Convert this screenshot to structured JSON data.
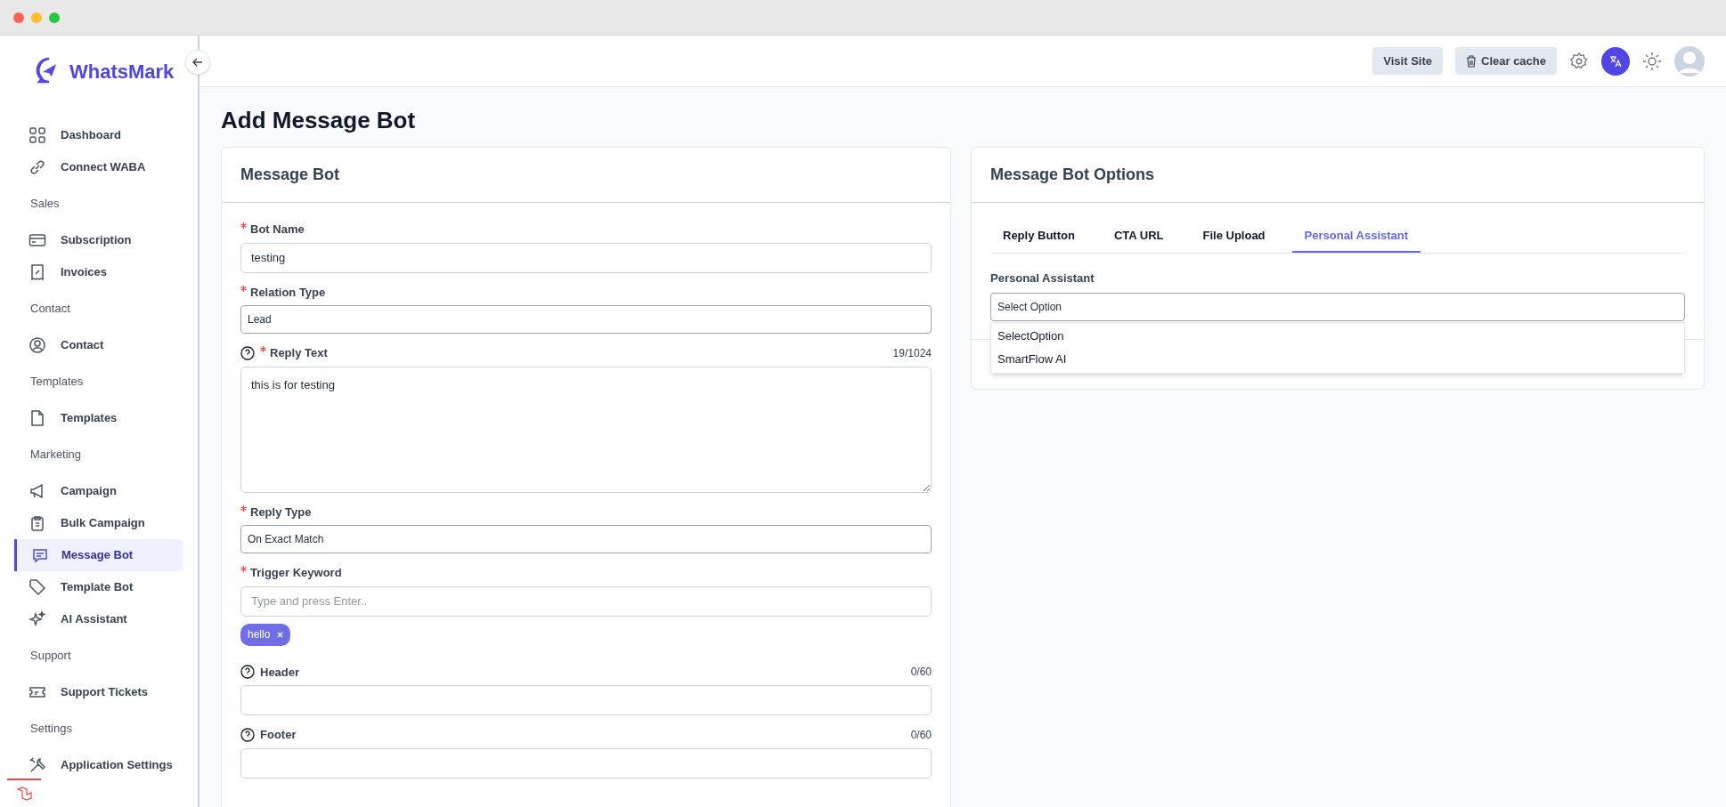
{
  "brand": {
    "name": "WhatsMark"
  },
  "sidebar": {
    "items": [
      {
        "kind": "item",
        "label": "Dashboard",
        "selected": false
      },
      {
        "kind": "item",
        "label": "Connect WABA",
        "selected": false
      },
      {
        "kind": "section",
        "label": "Sales"
      },
      {
        "kind": "item",
        "label": "Subscription",
        "selected": false
      },
      {
        "kind": "item",
        "label": "Invoices",
        "selected": false
      },
      {
        "kind": "section",
        "label": "Contact"
      },
      {
        "kind": "item",
        "label": "Contact",
        "selected": false
      },
      {
        "kind": "section",
        "label": "Templates"
      },
      {
        "kind": "item",
        "label": "Templates",
        "selected": false
      },
      {
        "kind": "section",
        "label": "Marketing"
      },
      {
        "kind": "item",
        "label": "Campaign",
        "selected": false
      },
      {
        "kind": "item",
        "label": "Bulk Campaign",
        "selected": false
      },
      {
        "kind": "item",
        "label": "Message Bot",
        "selected": true
      },
      {
        "kind": "item",
        "label": "Template Bot",
        "selected": false
      },
      {
        "kind": "item",
        "label": "AI Assistant",
        "selected": false
      },
      {
        "kind": "section",
        "label": "Support"
      },
      {
        "kind": "item",
        "label": "Support Tickets",
        "selected": false
      },
      {
        "kind": "section",
        "label": "Settings"
      },
      {
        "kind": "item",
        "label": "Application Settings",
        "selected": false
      }
    ]
  },
  "header": {
    "buttons": [
      {
        "label": "Visit Site"
      },
      {
        "label": "Clear cache"
      }
    ]
  },
  "page": {
    "title": "Add Message Bot"
  },
  "form": {
    "title": "Message Bot",
    "fields": [
      {
        "kind": "input",
        "label": "Bot Name",
        "required": true,
        "help": false,
        "value": "testing"
      },
      {
        "kind": "select",
        "label": "Relation Type",
        "required": true,
        "help": false,
        "value": "Lead"
      },
      {
        "kind": "textarea",
        "label": "Reply Text",
        "required": true,
        "help": true,
        "counter": "19/1024",
        "value": "this is for testing"
      },
      {
        "kind": "select",
        "label": "Reply Type",
        "required": true,
        "help": false,
        "value": "On Exact Match"
      },
      {
        "kind": "tags",
        "label": "Trigger Keyword",
        "required": true,
        "help": false,
        "placeholder": "Type and press Enter..",
        "tags": [
          "hello"
        ]
      },
      {
        "kind": "input",
        "label": "Header",
        "required": false,
        "help": true,
        "counter": "0/60"
      },
      {
        "kind": "input",
        "label": "Footer",
        "required": false,
        "help": true,
        "counter": "0/60"
      }
    ]
  },
  "options": {
    "title": "Message Bot Options",
    "tabs": [
      {
        "label": "Reply Button",
        "selected": false
      },
      {
        "label": "CTA URL",
        "selected": false
      },
      {
        "label": "File Upload",
        "selected": false
      },
      {
        "label": "Personal Assistant",
        "selected": true
      }
    ],
    "field": {
      "label": "Personal Assistant",
      "value": "Select Option",
      "dropdown": [
        "SelectOption",
        "SmartFlow AI"
      ]
    }
  }
}
